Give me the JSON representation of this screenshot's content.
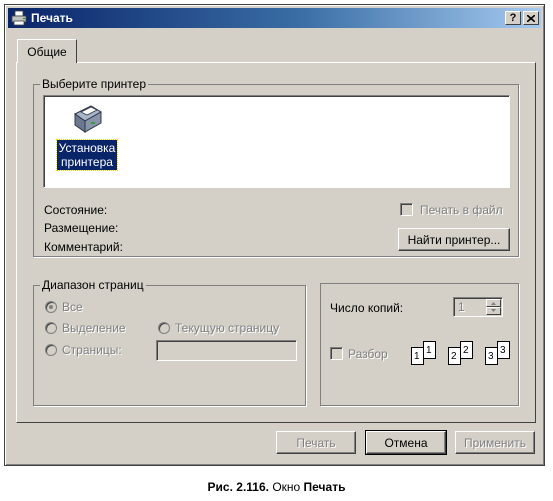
{
  "window": {
    "title": "Печать",
    "help_label": "?",
    "close_label": "X"
  },
  "tabs": [
    {
      "label": "Общие"
    }
  ],
  "printer_group": {
    "label": "Выберите принтер",
    "items": [
      {
        "label": "Установка\nпринтера"
      }
    ]
  },
  "status": {
    "state_label": "Состояние:",
    "location_label": "Размещение:",
    "comment_label": "Комментарий:",
    "print_to_file_label": "Печать в файл",
    "find_printer_label": "Найти принтер..."
  },
  "page_range": {
    "label": "Диапазон страниц",
    "all_label": "Все",
    "selection_label": "Выделение",
    "current_page_label": "Текущую страницу",
    "pages_label": "Страницы:",
    "selected": "all"
  },
  "copies": {
    "label": "Число копий:",
    "value": "1",
    "collate_label": "Разбор",
    "collate_pages": [
      "1",
      "1",
      "2",
      "2",
      "3",
      "3"
    ]
  },
  "footer": {
    "print_label": "Печать",
    "cancel_label": "Отмена",
    "apply_label": "Применить"
  },
  "caption": {
    "prefix": "Рис. 2.116.",
    "text": " Окно ",
    "bold": "Печать"
  },
  "colors": {
    "titlebar_start": "#0a246a",
    "titlebar_end": "#a6caf0",
    "face": "#d4d0c8",
    "selection": "#0a246a"
  },
  "icons": {
    "title": "printer-icon",
    "printer_item": "add-printer-icon"
  }
}
